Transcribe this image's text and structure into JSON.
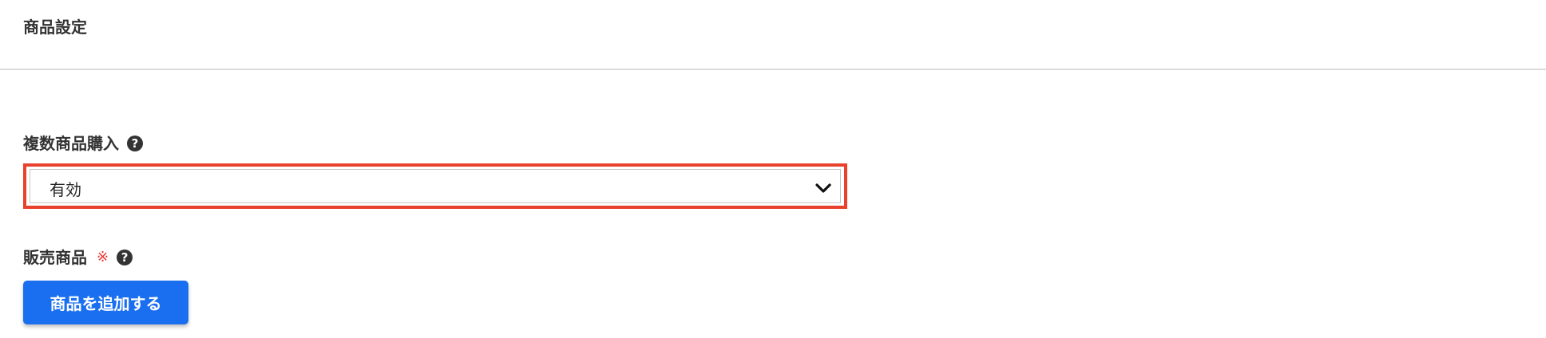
{
  "section": {
    "title": "商品設定"
  },
  "multi_purchase": {
    "label": "複数商品購入",
    "help_icon": "question-circle-icon",
    "select": {
      "value": "有効",
      "chevron_icon": "chevron-down-icon"
    },
    "highlight_color": "#e8412c"
  },
  "products": {
    "label": "販売商品",
    "required_mark": "※",
    "help_icon": "question-circle-icon",
    "add_button_label": "商品を追加する",
    "button_color": "#1a6ff0"
  }
}
